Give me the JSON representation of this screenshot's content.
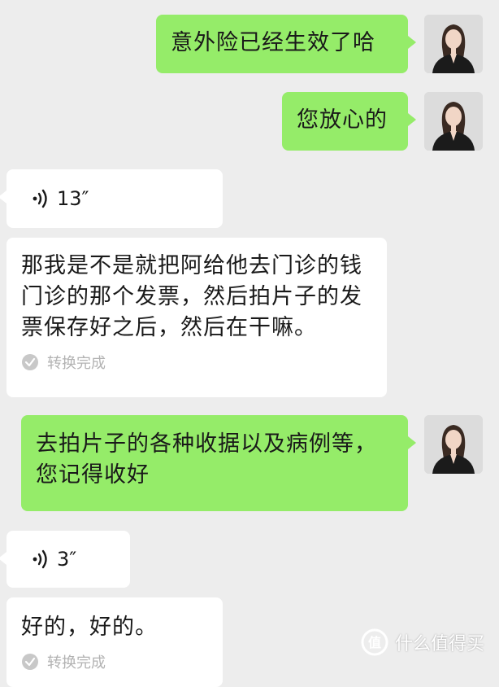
{
  "messages": [
    {
      "text": "意外险已经生效了哈"
    },
    {
      "text": "您放心的"
    },
    {
      "voice_duration": "13″"
    },
    {
      "text": "那我是不是就把阿给他去门诊的钱门诊的那个发票，然后拍片子的发票保存好之后，然后在干嘛。",
      "status": "转换完成"
    },
    {
      "text": "去拍片子的各种收据以及病例等，您记得收好"
    },
    {
      "voice_duration": "3″"
    },
    {
      "text": "好的，好的。",
      "status": "转换完成"
    }
  ],
  "watermark": {
    "text": "什么值得买"
  },
  "colors": {
    "outgoing": "#95ec69",
    "incoming": "#ffffff",
    "background": "#ededed"
  },
  "icons": {
    "voice": "voice-wave-icon",
    "status": "check-circle-icon",
    "avatar": "avatar-icon",
    "watermark": "smzdm-logo-icon"
  }
}
